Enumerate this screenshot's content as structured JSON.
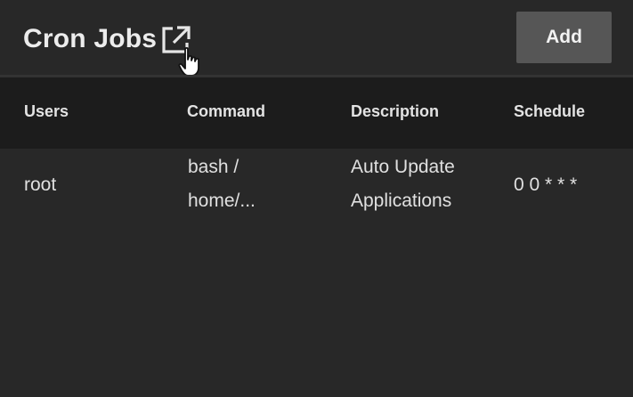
{
  "header": {
    "title": "Cron Jobs",
    "external_link_icon": "open-in-new-icon",
    "add_label": "Add"
  },
  "table": {
    "columns": [
      "Users",
      "Command",
      "Description",
      "Schedule"
    ],
    "rows": [
      {
        "user": "root",
        "command_line1": "bash /",
        "command_line2": "home/...",
        "description_line1": "Auto Update",
        "description_line2": "Applications",
        "schedule": "0 0 * * *"
      }
    ]
  },
  "colors": {
    "background": "#282828",
    "header_row": "#1c1c1c",
    "button": "#565656",
    "text": "#e6e6e6"
  }
}
